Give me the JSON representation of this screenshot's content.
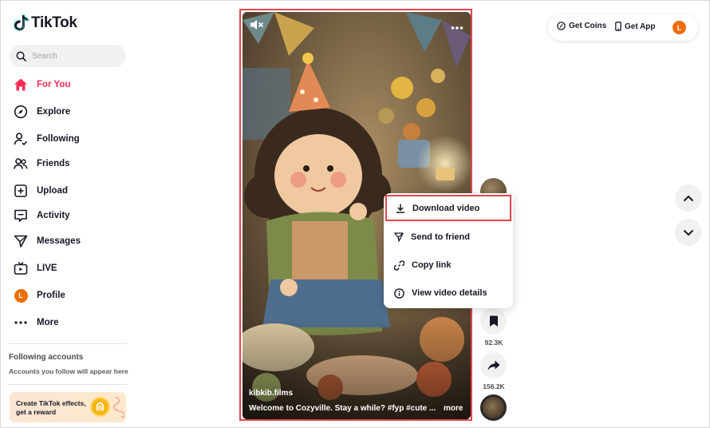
{
  "app": {
    "name": "TikTok"
  },
  "search": {
    "placeholder": "Search"
  },
  "nav": {
    "items": [
      {
        "label": "For You",
        "icon": "home-icon"
      },
      {
        "label": "Explore",
        "icon": "compass-icon"
      },
      {
        "label": "Following",
        "icon": "person-check-icon"
      },
      {
        "label": "Friends",
        "icon": "friends-icon"
      },
      {
        "label": "Upload",
        "icon": "plus-square-icon"
      },
      {
        "label": "Activity",
        "icon": "message-box-icon"
      },
      {
        "label": "Messages",
        "icon": "paper-plane-icon"
      },
      {
        "label": "LIVE",
        "icon": "tv-icon"
      },
      {
        "label": "Profile",
        "icon": "avatar"
      },
      {
        "label": "More",
        "icon": "ellipsis-icon"
      }
    ],
    "profile_initial": "L"
  },
  "following_accounts": {
    "title": "Following accounts",
    "subtitle": "Accounts you follow will appear here"
  },
  "promo": {
    "line1": "Create TikTok effects,",
    "line2": "get a reward"
  },
  "header": {
    "get_coins": "Get Coins",
    "get_app": "Get App",
    "avatar_initial": "L"
  },
  "video": {
    "author": "kibkib.films",
    "caption": "Welcome to Cozyville. Stay a while? #fyp #cute ...",
    "more": "more"
  },
  "actions": {
    "bookmark_count": "92.3K",
    "share_count": "156.2K"
  },
  "menu": {
    "items": [
      {
        "label": "Download video",
        "icon": "download-icon"
      },
      {
        "label": "Send to friend",
        "icon": "paper-plane-icon"
      },
      {
        "label": "Copy link",
        "icon": "link-icon"
      },
      {
        "label": "View video details",
        "icon": "info-icon"
      }
    ]
  },
  "colors": {
    "accent": "#fe2c55",
    "highlight_border": "#e0474c",
    "avatar": "#ee6d0a"
  }
}
